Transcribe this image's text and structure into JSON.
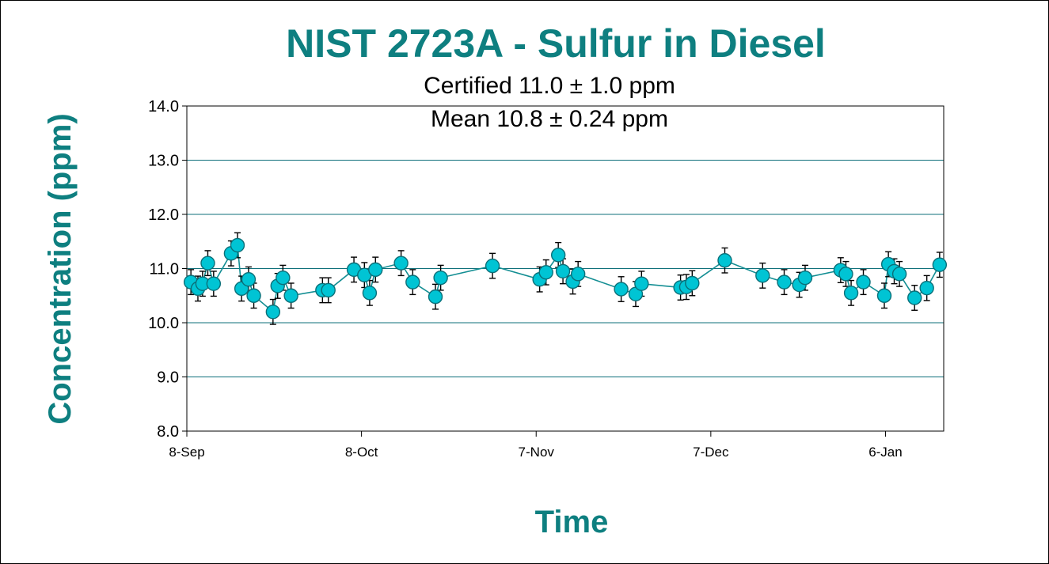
{
  "chart_data": {
    "type": "scatter",
    "title": "NIST 2723A - Sulfur in Diesel",
    "subtitle_lines": [
      "Certified 11.0 ± 1.0 ppm",
      "Mean 10.8 ± 0.24 ppm"
    ],
    "xlabel": "Time",
    "ylabel": "Concentration (ppm)",
    "ylim": [
      8.0,
      14.0
    ],
    "yticks": [
      "8.0",
      "9.0",
      "10.0",
      "11.0",
      "12.0",
      "13.0",
      "14.0"
    ],
    "xlim": [
      0,
      130
    ],
    "xticks": [
      {
        "label": "8-Sep",
        "x": 0
      },
      {
        "label": "8-Oct",
        "x": 30
      },
      {
        "label": "7-Nov",
        "x": 60
      },
      {
        "label": "7-Dec",
        "x": 90
      },
      {
        "label": "6-Jan",
        "x": 120
      }
    ],
    "grid": "horizontal",
    "legend": "none",
    "error_bar": 0.23,
    "colors": {
      "marker_fill": "#00c4d4",
      "marker_edge": "#0b6f78",
      "line": "#138e93",
      "grid": "#0e6f7a",
      "text_accent": "#0e7f80"
    },
    "series": [
      {
        "x": [
          0.7,
          1.9,
          2.7,
          3.6,
          4.6,
          7.6,
          8.7,
          9.4,
          10.6,
          11.5,
          14.8,
          15.6,
          16.5,
          17.9,
          23.3,
          24.3,
          28.7,
          30.5,
          31.4,
          32.4,
          36.8,
          38.8,
          42.7,
          43.6,
          52.5,
          60.6,
          61.7,
          63.8,
          64.6,
          66.3,
          67.2,
          74.6,
          77.1,
          78.1,
          84.8,
          85.8,
          86.8,
          92.4,
          98.9,
          102.6,
          105.2,
          106.2,
          112.3,
          113.2,
          114.1,
          116.2,
          119.8,
          120.5,
          121.5,
          122.4,
          125.0,
          127.1,
          129.3
        ],
        "y": [
          10.75,
          10.63,
          10.72,
          11.1,
          10.72,
          11.28,
          11.43,
          10.63,
          10.8,
          10.5,
          10.2,
          10.68,
          10.83,
          10.5,
          10.6,
          10.6,
          10.98,
          10.88,
          10.55,
          10.98,
          11.1,
          10.75,
          10.48,
          10.83,
          11.05,
          10.8,
          10.93,
          11.25,
          10.95,
          10.76,
          10.9,
          10.62,
          10.53,
          10.72,
          10.65,
          10.66,
          10.73,
          11.15,
          10.87,
          10.75,
          10.7,
          10.83,
          10.97,
          10.9,
          10.55,
          10.75,
          10.5,
          11.08,
          10.95,
          10.9,
          10.46,
          10.64,
          11.07
        ]
      }
    ]
  }
}
